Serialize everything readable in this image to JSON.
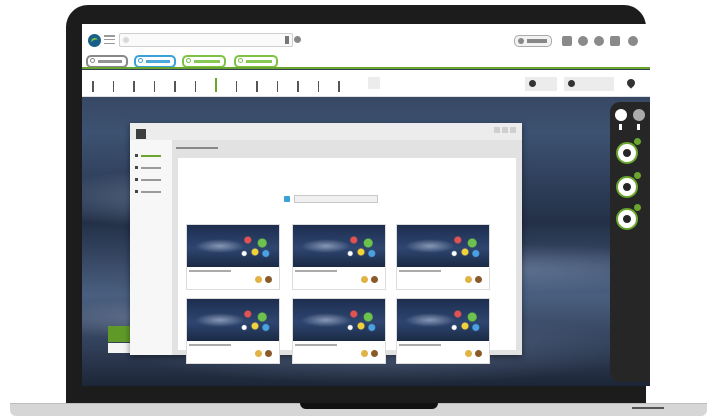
{
  "app": {
    "logo_icon": "app-logo",
    "menu_icon": "hamburger-menu-icon",
    "search": {
      "icon": "search-field"
    },
    "header_icons": [
      "square-icon",
      "circle-icon",
      "circle-icon",
      "square-icon",
      "circle-icon"
    ],
    "tags": [
      {
        "color": "#888888"
      },
      {
        "color": "#3aa0d8"
      },
      {
        "color": "#7dc242"
      },
      {
        "color": "#7dc242"
      }
    ],
    "accent_color": "#6aa52e"
  },
  "timeline": {
    "ticks": 13,
    "active_tick": 6,
    "fields": [
      "filter-field",
      "filter-field"
    ],
    "pin_icon": "location-pin-icon"
  },
  "right_sidebar": {
    "toggles": [
      "white-circle",
      "grey-circle"
    ],
    "layer_rings": 3,
    "ring_color": "#6aa52e"
  },
  "modal": {
    "sidebar_items": [
      {
        "active": true
      },
      {
        "active": false
      },
      {
        "active": false
      },
      {
        "active": false
      }
    ],
    "search_dot_color": "#3aa0d8",
    "cards": [
      {
        "thumb": "space-image-thumbnail",
        "avatars": [
          "avatar-gold",
          "avatar-brown"
        ]
      },
      {
        "thumb": "space-image-thumbnail",
        "avatars": [
          "avatar-gold",
          "avatar-brown"
        ]
      },
      {
        "thumb": "space-image-thumbnail",
        "avatars": [
          "avatar-gold",
          "avatar-brown"
        ]
      },
      {
        "thumb": "space-image-thumbnail",
        "avatars": [
          "avatar-gold",
          "avatar-brown"
        ]
      },
      {
        "thumb": "space-image-thumbnail",
        "avatars": [
          "avatar-gold",
          "avatar-brown"
        ]
      },
      {
        "thumb": "space-image-thumbnail",
        "avatars": [
          "avatar-gold",
          "avatar-brown"
        ]
      }
    ]
  }
}
